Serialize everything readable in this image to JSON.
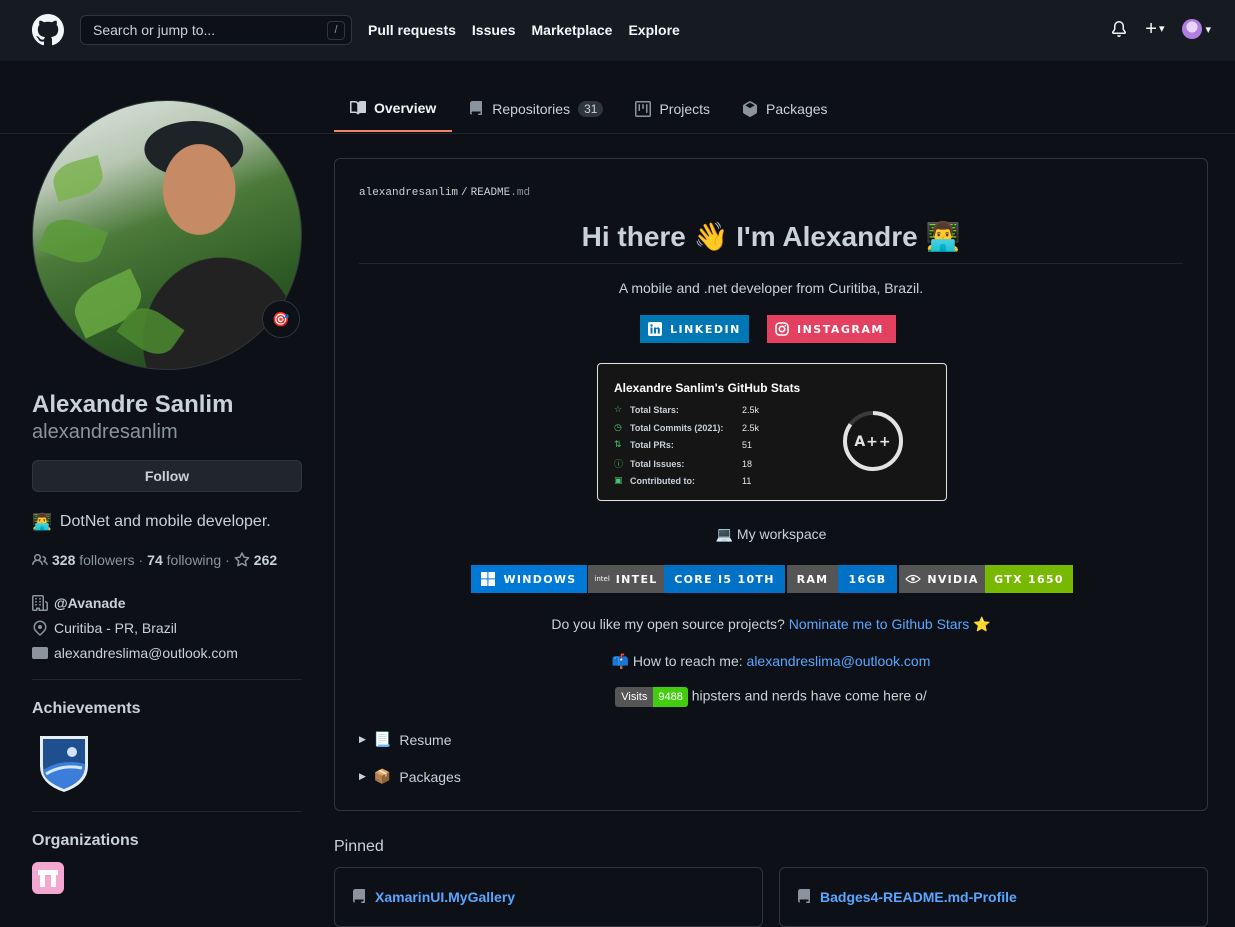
{
  "header": {
    "search_placeholder": "Search or jump to...",
    "search_shortcut": "/",
    "nav": [
      "Pull requests",
      "Issues",
      "Marketplace",
      "Explore"
    ],
    "plus_icon": "+",
    "caret": "▾"
  },
  "tabs": {
    "overview": "Overview",
    "repositories": "Repositories",
    "repositories_count": "31",
    "projects": "Projects",
    "packages": "Packages"
  },
  "profile": {
    "status_emoji": "🎯",
    "name": "Alexandre Sanlim",
    "login": "alexandresanlim",
    "follow_label": "Follow",
    "bio_emoji": "👨‍💻",
    "bio": "DotNet and mobile developer.",
    "followers_count": "328",
    "followers_label": "followers",
    "following_count": "74",
    "following_label": "following",
    "stars_count": "262",
    "company": "@Avanade",
    "location": "Curitiba - PR, Brazil",
    "email": "alexandreslima@outlook.com",
    "achievements_title": "Achievements",
    "organizations_title": "Organizations"
  },
  "readme": {
    "path_user": "alexandresanlim",
    "path_sep": "/",
    "path_file": "README",
    "path_ext": ".md",
    "heading": "Hi there 👋 I'm Alexandre 👨‍💻",
    "subtitle": "A mobile and .net developer from Curitiba, Brazil.",
    "linkedin": "LINKEDIN",
    "instagram": "INSTAGRAM",
    "stats": {
      "title": "Alexandre Sanlim's GitHub Stats",
      "rows": [
        {
          "label": "Total Stars:",
          "value": "2.5k",
          "icon": "☆"
        },
        {
          "label": "Total Commits (2021):",
          "value": "2.5k",
          "icon": "◷"
        },
        {
          "label": "Total PRs:",
          "value": "51",
          "icon": "⇅"
        },
        {
          "label": "Total Issues:",
          "value": "18",
          "icon": "ⓘ"
        },
        {
          "label": "Contributed to:",
          "value": "11",
          "icon": "▣"
        }
      ],
      "grade": "A++",
      "grade_progress": 0.85
    },
    "workspace_emoji": "💻",
    "workspace": "My workspace",
    "hardware": [
      {
        "text": "WINDOWS",
        "color": "#0078d6"
      },
      {
        "text": "INTEL",
        "color": "#555555"
      },
      {
        "text": "CORE I5 10TH",
        "color": "#0071c5"
      },
      {
        "text": "RAM",
        "color": "#555555"
      },
      {
        "text": "16GB",
        "color": "#0071c5"
      },
      {
        "text": "NVIDIA",
        "color": "#555555"
      },
      {
        "text": "GTX 1650",
        "color": "#76b900"
      }
    ],
    "intel_mark": "intel",
    "oss_text": "Do you like my open source projects?",
    "oss_link": "Nominate me to Github Stars",
    "oss_star": "⭐",
    "reach_emoji": "📫",
    "reach_text": "How to reach me:",
    "reach_email": "alexandreslima@outlook.com",
    "visits_label": "Visits",
    "visits_count": "9488",
    "visits_text": "hipsters and nerds have come here o/",
    "resume_emoji": "📃",
    "resume": "Resume",
    "packages_emoji": "📦",
    "packages": "Packages"
  },
  "pinned": {
    "title": "Pinned",
    "items": [
      "XamarinUI.MyGallery",
      "Badges4-README.md-Profile"
    ]
  }
}
